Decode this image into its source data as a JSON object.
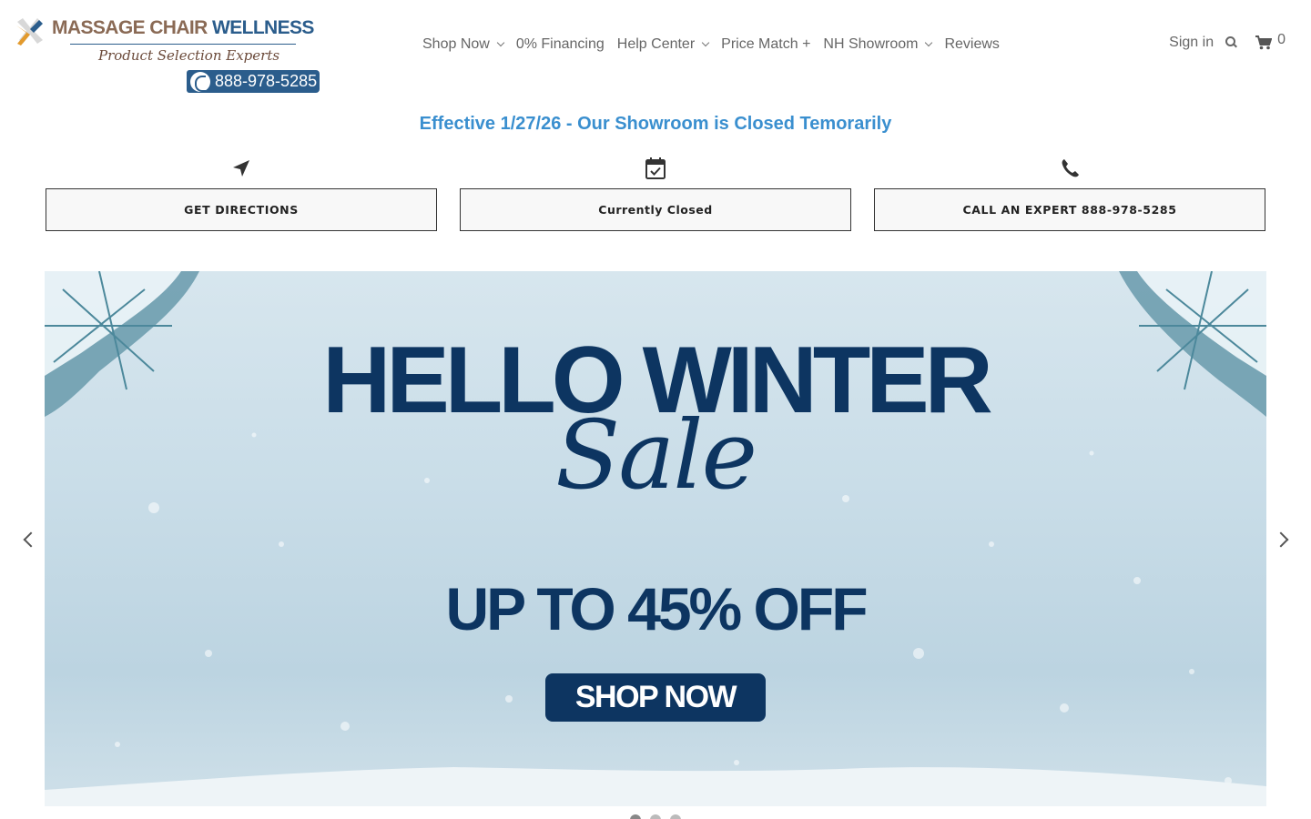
{
  "header": {
    "logo": {
      "name_part1": "MASSAGE CHAIR",
      "name_part2": "WELLNESS",
      "tagline": "Product Selection Experts",
      "phone": "888-978-5285"
    },
    "nav": [
      {
        "label": "Shop Now",
        "has_dropdown": true
      },
      {
        "label": "0% Financing",
        "has_dropdown": false
      },
      {
        "label": "Help Center",
        "has_dropdown": true
      },
      {
        "label": "Price Match +",
        "has_dropdown": false
      },
      {
        "label": "NH Showroom",
        "has_dropdown": true
      },
      {
        "label": "Reviews",
        "has_dropdown": false
      }
    ],
    "sign_in": "Sign in",
    "cart_count": "0"
  },
  "notice": "Effective 1/27/26 - Our Showroom is Closed Temorarily",
  "actions": [
    {
      "icon": "navigation-arrow-icon",
      "label": "GET DIRECTIONS"
    },
    {
      "icon": "calendar-check-icon",
      "label": "Currently Closed"
    },
    {
      "icon": "phone-icon",
      "label": "CALL AN EXPERT 888-978-5285"
    }
  ],
  "hero": {
    "title": "HELLO WINTER",
    "script": "Sale",
    "offer": "UP TO 45% OFF",
    "cta": "SHOP NOW"
  },
  "colors": {
    "notice_blue": "#3a8fcf",
    "brand_navy": "#0d3561",
    "logo_blue": "#2b5d8c",
    "logo_brown": "#8a6a55"
  }
}
